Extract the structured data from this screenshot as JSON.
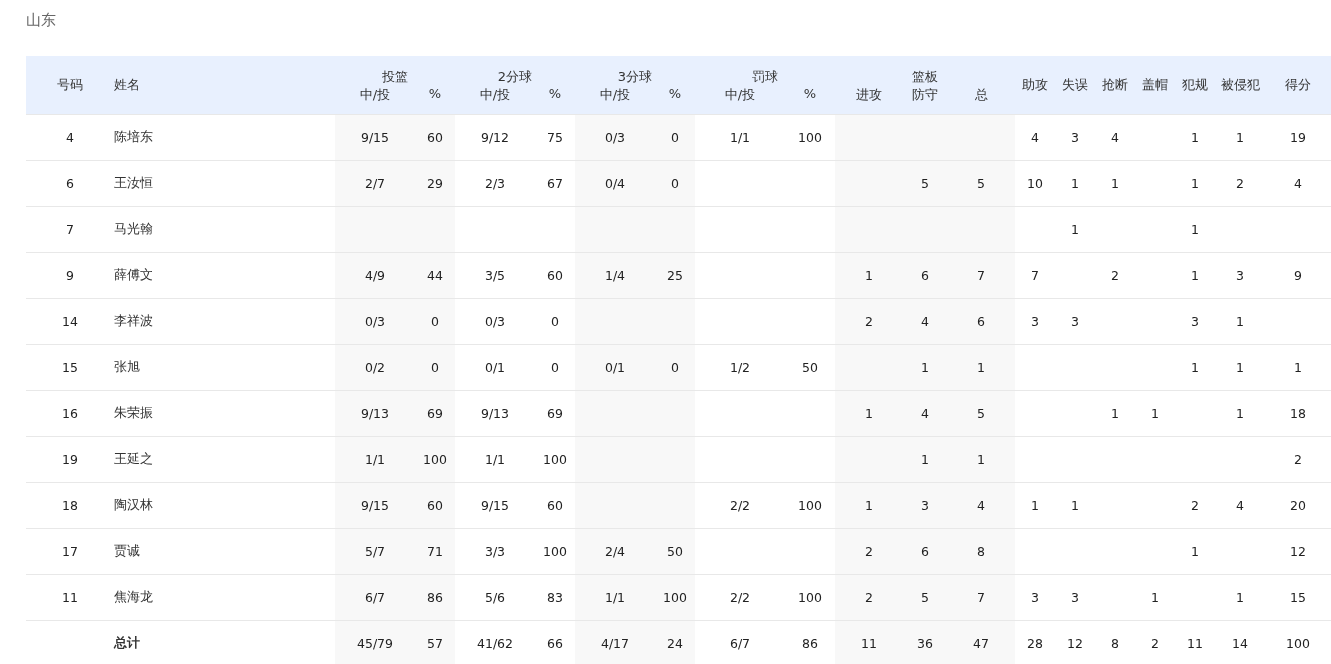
{
  "title": "山东",
  "columns": [
    {
      "label": "号码"
    },
    {
      "label": "姓名"
    },
    {
      "label": "投篮",
      "sub": [
        "中/投",
        "%"
      ]
    },
    {
      "label": "2分球",
      "sub": [
        "中/投",
        "%"
      ]
    },
    {
      "label": "3分球",
      "sub": [
        "中/投",
        "%"
      ]
    },
    {
      "label": "罚球",
      "sub": [
        "中/投",
        "%"
      ]
    },
    {
      "label": "篮板",
      "sub": [
        "进攻",
        "防守",
        "总"
      ]
    },
    {
      "label": "助攻"
    },
    {
      "label": "失误"
    },
    {
      "label": "抢断"
    },
    {
      "label": "盖帽"
    },
    {
      "label": "犯规"
    },
    {
      "label": "被侵犯"
    },
    {
      "label": "得分"
    }
  ],
  "rows": [
    {
      "kind": "player",
      "cells": [
        "4",
        "陈培东",
        "9/15",
        "60",
        "9/12",
        "75",
        "0/3",
        "0",
        "1/1",
        "100",
        null,
        null,
        null,
        "4",
        "3",
        "4",
        null,
        "1",
        "1",
        "19"
      ]
    },
    {
      "kind": "player",
      "cells": [
        "6",
        "王汝恒",
        "2/7",
        "29",
        "2/3",
        "67",
        "0/4",
        "0",
        null,
        null,
        null,
        "5",
        "5",
        "10",
        "1",
        "1",
        null,
        "1",
        "2",
        "4"
      ]
    },
    {
      "kind": "player",
      "cells": [
        "7",
        "马光翰",
        null,
        null,
        null,
        null,
        null,
        null,
        null,
        null,
        null,
        null,
        null,
        null,
        "1",
        null,
        null,
        "1",
        null,
        null
      ]
    },
    {
      "kind": "player",
      "cells": [
        "9",
        "薛傅文",
        "4/9",
        "44",
        "3/5",
        "60",
        "1/4",
        "25",
        null,
        null,
        "1",
        "6",
        "7",
        "7",
        null,
        "2",
        null,
        "1",
        "3",
        "9"
      ]
    },
    {
      "kind": "player",
      "cells": [
        "14",
        "李祥波",
        "0/3",
        "0",
        "0/3",
        "0",
        null,
        null,
        null,
        null,
        "2",
        "4",
        "6",
        "3",
        "3",
        null,
        null,
        "3",
        "1",
        null
      ]
    },
    {
      "kind": "player",
      "cells": [
        "15",
        "张旭",
        "0/2",
        "0",
        "0/1",
        "0",
        "0/1",
        "0",
        "1/2",
        "50",
        null,
        "1",
        "1",
        null,
        null,
        null,
        null,
        "1",
        "1",
        "1"
      ]
    },
    {
      "kind": "player",
      "cells": [
        "16",
        "朱荣振",
        "9/13",
        "69",
        "9/13",
        "69",
        null,
        null,
        null,
        null,
        "1",
        "4",
        "5",
        null,
        null,
        "1",
        "1",
        null,
        "1",
        "18"
      ]
    },
    {
      "kind": "player",
      "cells": [
        "19",
        "王延之",
        "1/1",
        "100",
        "1/1",
        "100",
        null,
        null,
        null,
        null,
        null,
        "1",
        "1",
        null,
        null,
        null,
        null,
        null,
        null,
        "2"
      ]
    },
    {
      "kind": "player",
      "cells": [
        "18",
        "陶汉林",
        "9/15",
        "60",
        "9/15",
        "60",
        null,
        null,
        "2/2",
        "100",
        "1",
        "3",
        "4",
        "1",
        "1",
        null,
        null,
        "2",
        "4",
        "20"
      ]
    },
    {
      "kind": "player",
      "cells": [
        "17",
        "贾诚",
        "5/7",
        "71",
        "3/3",
        "100",
        "2/4",
        "50",
        null,
        null,
        "2",
        "6",
        "8",
        null,
        null,
        null,
        null,
        "1",
        null,
        "12"
      ]
    },
    {
      "kind": "player",
      "cells": [
        "11",
        "焦海龙",
        "6/7",
        "86",
        "5/6",
        "83",
        "1/1",
        "100",
        "2/2",
        "100",
        "2",
        "5",
        "7",
        "3",
        "3",
        null,
        "1",
        null,
        "1",
        "15"
      ]
    },
    {
      "kind": "total",
      "cells": [
        null,
        "总计",
        "45/79",
        "57",
        "41/62",
        "66",
        "4/17",
        "24",
        "6/7",
        "86",
        "11",
        "36",
        "47",
        "28",
        "12",
        "8",
        "2",
        "11",
        "14",
        "100"
      ]
    }
  ]
}
